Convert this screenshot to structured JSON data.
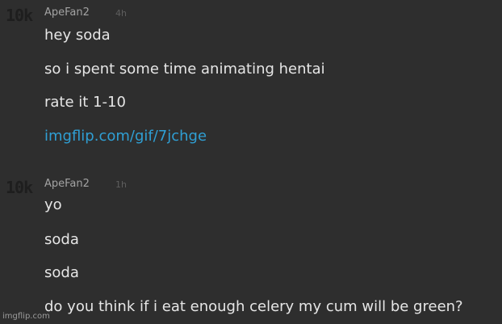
{
  "messages": [
    {
      "badge": "10k",
      "username": "ApeFan2",
      "time": "4h",
      "lines": [
        "hey soda",
        "so i spent some time animating hentai",
        "rate it 1-10",
        "imgflip.com/gif/7jchge"
      ]
    },
    {
      "badge": "10k",
      "username": "ApeFan2",
      "time": "1h",
      "lines": [
        "yo",
        "soda",
        "soda",
        "do you think if i eat enough celery my cum will be green?"
      ]
    }
  ],
  "watermark": "imgflip.com",
  "colors": {
    "background": "#2e2e2e",
    "text": "#e6e6e6",
    "link": "#2f9fd4",
    "username": "#a3a3a3",
    "timestamp": "#5e5e5e",
    "badge": "#1e1e1e"
  }
}
